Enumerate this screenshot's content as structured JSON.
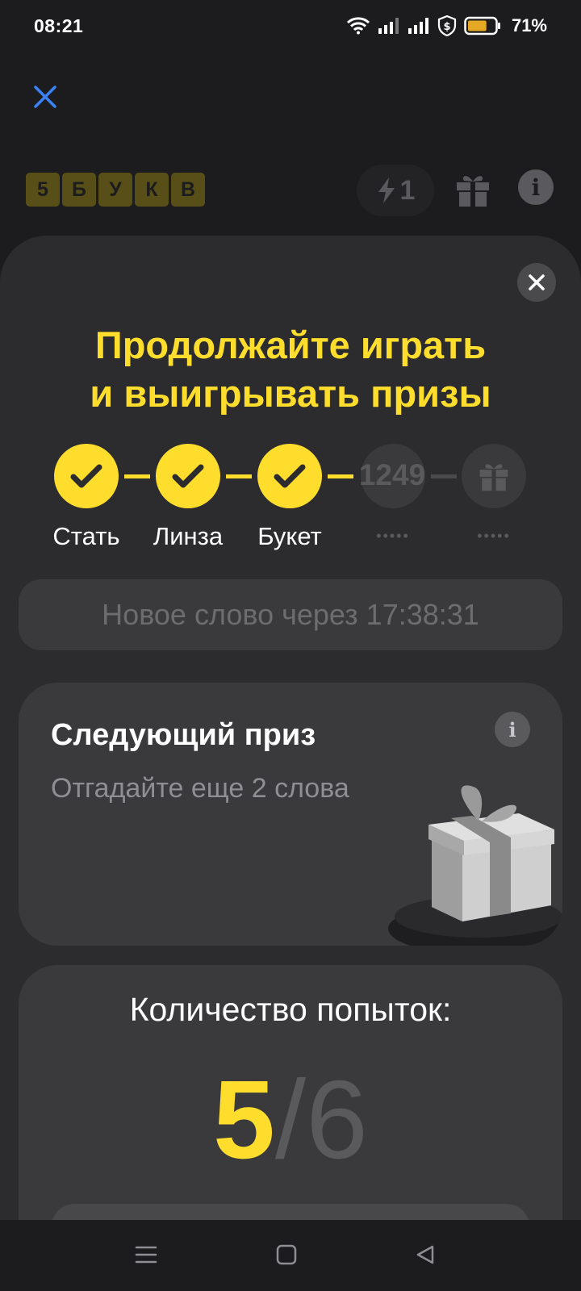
{
  "status_bar": {
    "time": "08:21",
    "battery_percent": "71%",
    "battery_level": 0.71,
    "icons": [
      "wifi-icon",
      "signal-icon",
      "signal-icon",
      "shield-dollar-icon",
      "battery-icon"
    ]
  },
  "game_header": {
    "logo_letters": [
      "5",
      "Б",
      "У",
      "К",
      "В"
    ],
    "energy_count": "1"
  },
  "sheet": {
    "title_line1": "Продолжайте играть",
    "title_line2": "и выигрывать призы",
    "progress": {
      "steps": [
        {
          "label": "Стать",
          "state": "done"
        },
        {
          "label": "Линза",
          "state": "done"
        },
        {
          "label": "Букет",
          "state": "done"
        },
        {
          "label": "",
          "state": "locked",
          "placeholder": "•••••"
        },
        {
          "label": "",
          "state": "gift",
          "placeholder": "•••••"
        }
      ],
      "number": "1249"
    },
    "timer_text": "Новое слово через 17:38:31",
    "next_prize": {
      "title": "Следующий приз",
      "subtitle": "Отгадайте еще 2 слова"
    },
    "attempts": {
      "label": "Количество попыток:",
      "current": "5",
      "separator": "/",
      "total": "6"
    }
  },
  "colors": {
    "accent_yellow": "#fedd2c",
    "sheet_bg": "#2c2c2e",
    "card_bg": "#3a3a3c",
    "close_blue": "#3b82f6"
  }
}
